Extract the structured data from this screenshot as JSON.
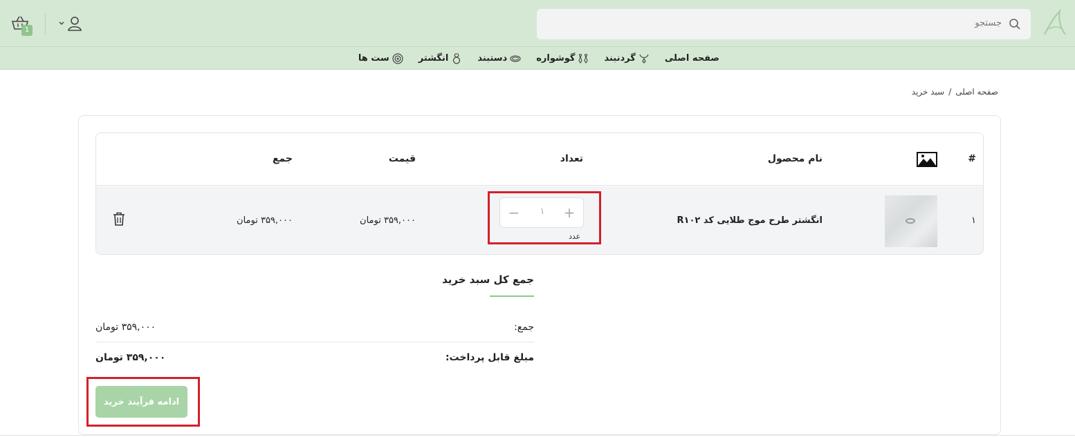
{
  "header": {
    "search_placeholder": "جستجو",
    "cart_count": "1"
  },
  "nav": {
    "items": [
      {
        "label": "صفحه اصلی"
      },
      {
        "label": "گردنبند"
      },
      {
        "label": "گوشواره"
      },
      {
        "label": "دستبند"
      },
      {
        "label": "انگشتر"
      },
      {
        "label": "ست ها"
      }
    ]
  },
  "breadcrumb": {
    "home": "صفحه اصلی",
    "sep": "/",
    "current": "سبد خرید"
  },
  "table": {
    "headers": {
      "index": "#",
      "name": "نام محصول",
      "qty": "تعداد",
      "price": "قیمت",
      "total": "جمع"
    },
    "rows": [
      {
        "index": "۱",
        "name": "انگشتر طرح موج طلایی کد R۱۰۲",
        "qty": "۱",
        "qty_unit": "عدد",
        "price": "۳۵۹,۰۰۰ تومان",
        "total": "۳۵۹,۰۰۰ تومان"
      }
    ]
  },
  "totals": {
    "title": "جمع کل سبد خرید",
    "subtotal_label": "جمع:",
    "subtotal_value": "۳۵۹,۰۰۰ تومان",
    "payable_label": "مبلغ قابل پرداخت:",
    "payable_value": "۳۵۹,۰۰۰ تومان",
    "checkout_label": "ادامه فرآیند خرید"
  },
  "colors": {
    "header_bg": "#d5e8d4",
    "accent": "#8fc58d",
    "checkout_bg": "#a9d4a7",
    "highlight": "#d3202a"
  }
}
